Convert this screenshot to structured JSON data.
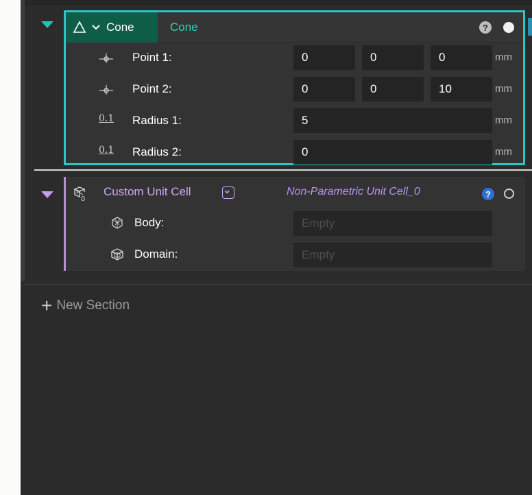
{
  "cone": {
    "type_label": "Cone",
    "name": "Cone",
    "help_label": "?",
    "rows": [
      {
        "icon": "point-icon",
        "label": "Point 1:",
        "values": [
          "0",
          "0",
          "0"
        ],
        "unit": "mm"
      },
      {
        "icon": "point-icon",
        "label": "Point 2:",
        "values": [
          "0",
          "0",
          "10"
        ],
        "unit": "mm"
      },
      {
        "icon": "decimal-number-icon",
        "icon_text": "0.1",
        "label": "Radius 1:",
        "value": "5",
        "unit": "mm"
      },
      {
        "icon": "decimal-number-icon",
        "icon_text": "0.1",
        "label": "Radius 2:",
        "value": "0",
        "unit": "mm"
      }
    ]
  },
  "unit_cell": {
    "title": "Custom Unit Cell",
    "name": "Non-Parametric Unit Cell_0",
    "help_label": "?",
    "rows": [
      {
        "icon": "body-mesh-icon",
        "label": "Body:",
        "placeholder": "Empty"
      },
      {
        "icon": "domain-box-icon",
        "label": "Domain:",
        "placeholder": "Empty"
      }
    ]
  },
  "new_section": {
    "plus": "+",
    "label": "New Section"
  },
  "colors": {
    "panel_bg": "#2b2b2b",
    "cone_accent": "#2fd3b3",
    "cone_border": "#29c7c7",
    "unit_cell_accent": "#cda8f5",
    "help_blue": "#2f6fd6"
  }
}
